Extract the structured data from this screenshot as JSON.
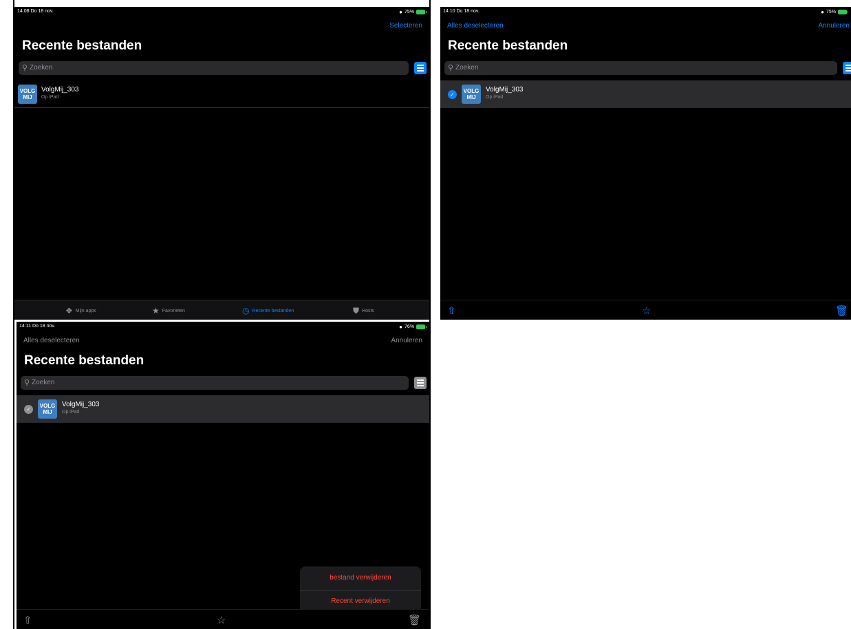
{
  "screens": [
    {
      "status": {
        "time": "14:08  Do 18 nov.",
        "battery": "75%"
      },
      "nav_right": "Selecteren",
      "title": "Recente bestanden",
      "search_placeholder": "Zoeken",
      "file": {
        "icon_text_top": "VOLG",
        "icon_text_bottom": "MIJ",
        "name": "VolgMij_303",
        "location": "Op iPad"
      },
      "tabs": [
        {
          "label": "Mijn apps",
          "icon": "apps-icon"
        },
        {
          "label": "Favorieten",
          "icon": "star-icon"
        },
        {
          "label": "Recente bestanden",
          "icon": "clock-icon",
          "active": true
        },
        {
          "label": "Hosts",
          "icon": "server-icon"
        }
      ]
    },
    {
      "status": {
        "time": "14:10  Do 18 nov.",
        "battery": "75%"
      },
      "nav_left": "Alles deselecteren",
      "nav_right": "Annuleren",
      "title": "Recente bestanden",
      "search_placeholder": "Zoeken",
      "file": {
        "icon_text_top": "VOLG",
        "icon_text_bottom": "MIJ",
        "name": "VolgMij_303",
        "location": "Op iPad",
        "selected": true
      }
    },
    {
      "status": {
        "time": "14:11  Do 18 nov.",
        "battery": "76%"
      },
      "nav_left": "Alles deselecteren",
      "nav_right": "Annuleren",
      "title": "Recente bestanden",
      "search_placeholder": "Zoeken",
      "file": {
        "icon_text_top": "VOLG",
        "icon_text_bottom": "MIJ",
        "name": "VolgMij_303",
        "location": "Op iPad",
        "selected": true
      },
      "menu": {
        "delete_file": "bestand verwijderen",
        "delete_recent": "Recent verwijderen"
      }
    }
  ],
  "colors": {
    "accent": "#0a84ff",
    "destructive": "#ff453a",
    "battery": "#34c759",
    "icon_bg": "#3d7fbf"
  }
}
